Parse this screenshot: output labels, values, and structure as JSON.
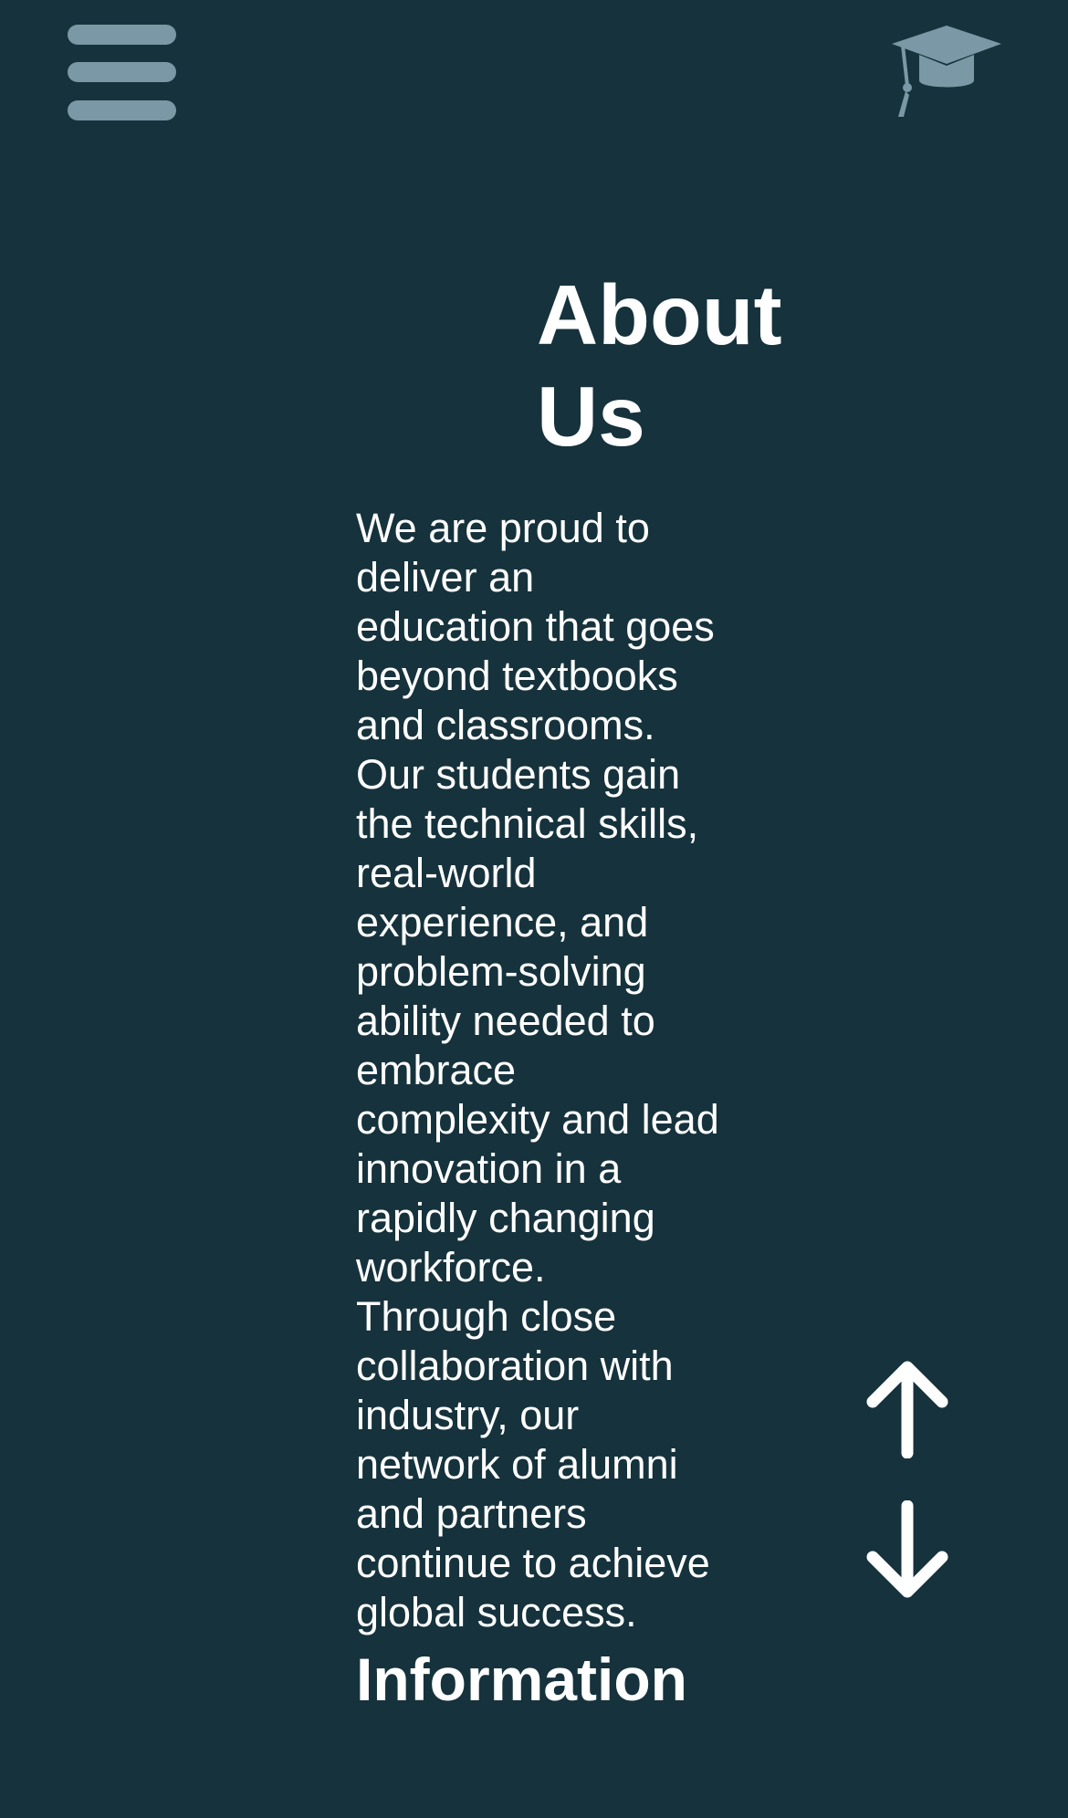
{
  "header": {
    "menu_icon": "hamburger-menu-icon",
    "logo_icon": "graduation-cap-icon",
    "logo_color": "#7a98a6"
  },
  "main": {
    "title": "About Us",
    "paragraphs": [
      "We are proud to deliver an education that goes beyond textbooks and classrooms.",
      "Our students gain the technical skills, real-world experience, and problem-solving ability needed to embrace complexity and lead innovation in a rapidly changing workforce.",
      "Through close collaboration with industry, our network of alumni and partners continue to achieve global success."
    ],
    "next_heading": "Information"
  },
  "scroll_controls": {
    "up_icon": "arrow-up-icon",
    "down_icon": "arrow-down-icon"
  },
  "colors": {
    "background": "#16323c",
    "text": "#ffffff",
    "accent": "#7a98a6"
  }
}
